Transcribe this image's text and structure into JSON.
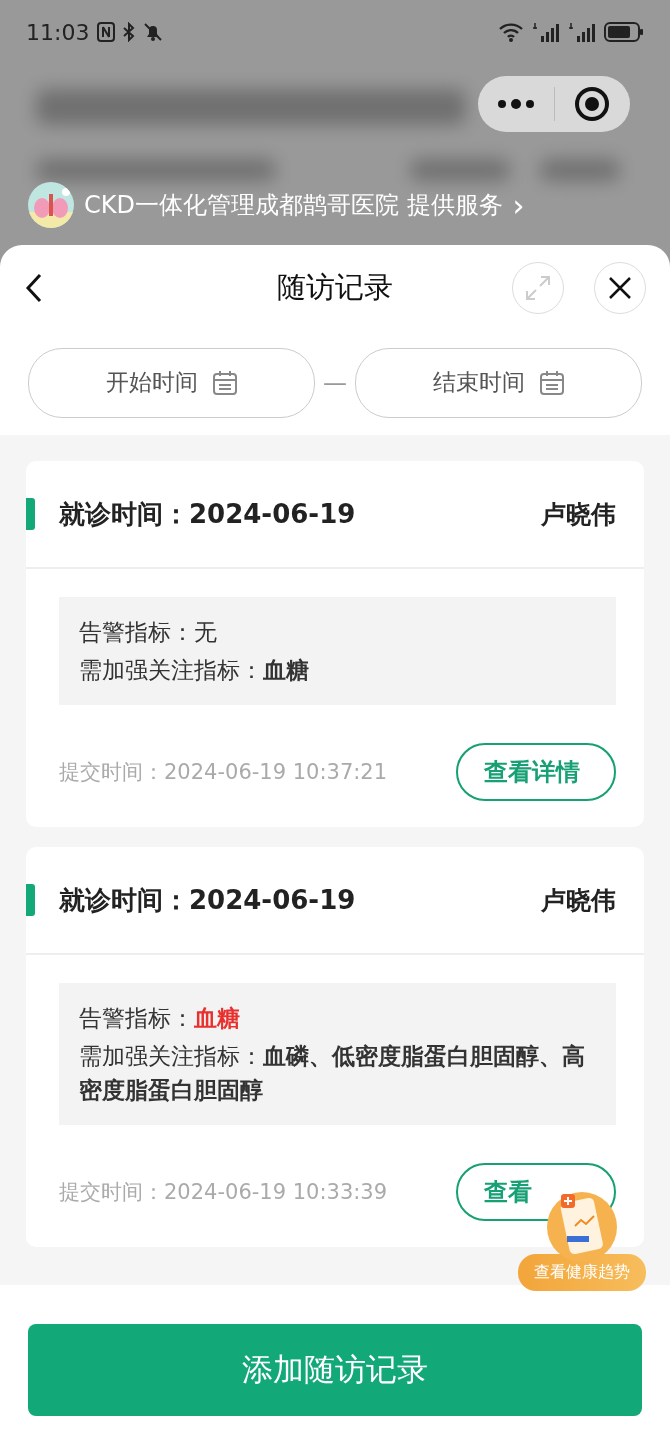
{
  "status_bar": {
    "time": "11:03"
  },
  "provider": {
    "text": "CKD一体化管理成都鹊哥医院 提供服务",
    "chevron": "›"
  },
  "sheet": {
    "title": "随访记录",
    "start_placeholder": "开始时间",
    "end_placeholder": "结束时间",
    "separator": "—"
  },
  "records": [
    {
      "visit_label": "就诊时间：",
      "visit_date": "2024-06-19",
      "doctor": "卢晓伟",
      "lines": [
        {
          "label": "告警指标：",
          "value": "无",
          "kind": "plain"
        },
        {
          "label": "需加强关注指标：",
          "value": "血糖",
          "kind": "bold"
        }
      ],
      "submit": "提交时间：2024-06-19 10:37:21",
      "button": "查看详情"
    },
    {
      "visit_label": "就诊时间：",
      "visit_date": "2024-06-19",
      "doctor": "卢晓伟",
      "lines": [
        {
          "label": "告警指标：",
          "value": "血糖",
          "kind": "alert"
        },
        {
          "label": "需加强关注指标：",
          "value": "血磷、低密度脂蛋白胆固醇、高密度脂蛋白胆固醇",
          "kind": "bold"
        }
      ],
      "submit": "提交时间：2024-06-19 10:33:39",
      "button": "查看"
    }
  ],
  "floating": {
    "label": "查看健康趋势"
  },
  "add_button": "添加随访记录"
}
